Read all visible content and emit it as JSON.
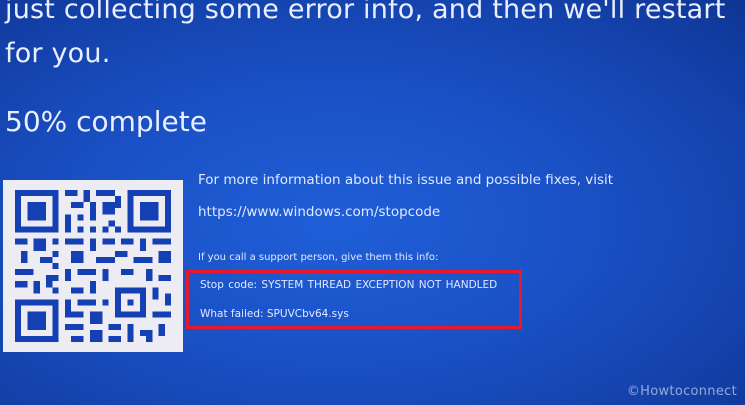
{
  "bsod": {
    "message": "just collecting some error info, and then we'll restart for you.",
    "progress_text": "50% complete",
    "info_more": "For more information about this issue and possible fixes, visit",
    "info_url": "https://www.windows.com/stopcode",
    "support_text": "If you call a support person, give them this info:",
    "stop_code_line": "Stop code: SYSTEM THREAD EXCEPTION NOT HANDLED",
    "what_failed_line": "What failed: SPUVCbv64.sys"
  },
  "qr_code": {
    "icon": "qr-code-icon",
    "foreground": "#1540b4",
    "background": "#ececf2"
  },
  "annotation": {
    "highlight_color": "#e8182d"
  },
  "watermark": {
    "text": "©Howtoconnect"
  },
  "colors": {
    "screen_blue": "#1a50c4",
    "text": "#e9efff"
  }
}
